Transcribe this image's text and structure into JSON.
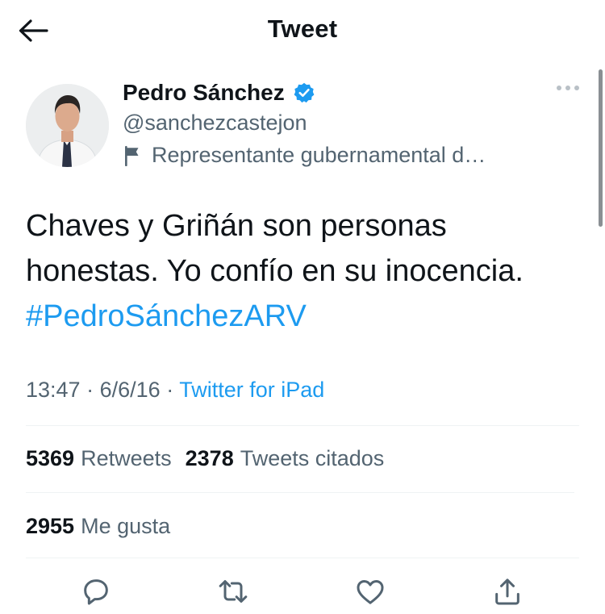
{
  "header": {
    "title": "Tweet"
  },
  "author": {
    "name": "Pedro Sánchez",
    "handle": "@sanchezcastejon",
    "label": "Representante gubernamental d…"
  },
  "tweet": {
    "text": "Chaves y Griñán son personas honestas. Yo confío en su inocencia.",
    "hashtag": "#PedroSánchezARV"
  },
  "meta": {
    "time": "13:47",
    "date": "6/6/16",
    "source": "Twitter for iPad",
    "separator": "·"
  },
  "stats": {
    "retweets_count": "5369",
    "retweets_label": "Retweets",
    "quotes_count": "2378",
    "quotes_label": "Tweets citados",
    "likes_count": "2955",
    "likes_label": "Me gusta"
  },
  "icons": {
    "back": "back-arrow-icon",
    "verified": "verified-badge-icon",
    "flag": "flag-icon",
    "more": "more-options-icon",
    "reply": "reply-icon",
    "retweet": "retweet-icon",
    "like": "heart-icon",
    "share": "share-icon"
  },
  "colors": {
    "accent": "#1d9bf0",
    "text": "#0f1419",
    "secondary": "#536471"
  }
}
